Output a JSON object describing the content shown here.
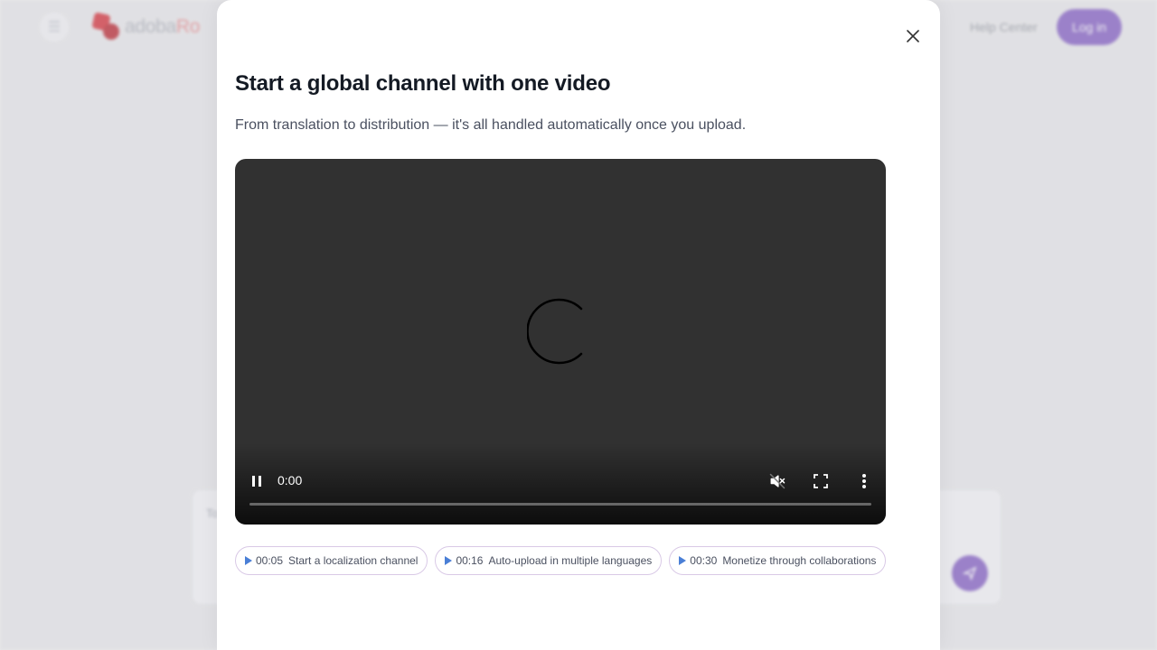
{
  "background": {
    "logo": {
      "text_main": "adoba",
      "text_accent": "Ro"
    },
    "header": {
      "help_label": "Help Center",
      "login_label": "Log in"
    },
    "card": {
      "partial_text": "To"
    }
  },
  "modal": {
    "title": "Start a global channel with one video",
    "subtitle": "From translation to distribution — it's all handled automatically once you upload."
  },
  "video": {
    "state": "loading",
    "current_time": "0:00",
    "progress": 0,
    "muted": true
  },
  "chapters": [
    {
      "time": "00:05",
      "label": "Start a localization channel"
    },
    {
      "time": "00:16",
      "label": "Auto-upload in multiple languages"
    },
    {
      "time": "00:30",
      "label": "Monetize through collaborations"
    }
  ],
  "colors": {
    "brand_purple": "#7e57c2",
    "logo_red": "#d4262e",
    "chip_play": "#4a7fd6",
    "chip_border": "#d9c9e6"
  }
}
